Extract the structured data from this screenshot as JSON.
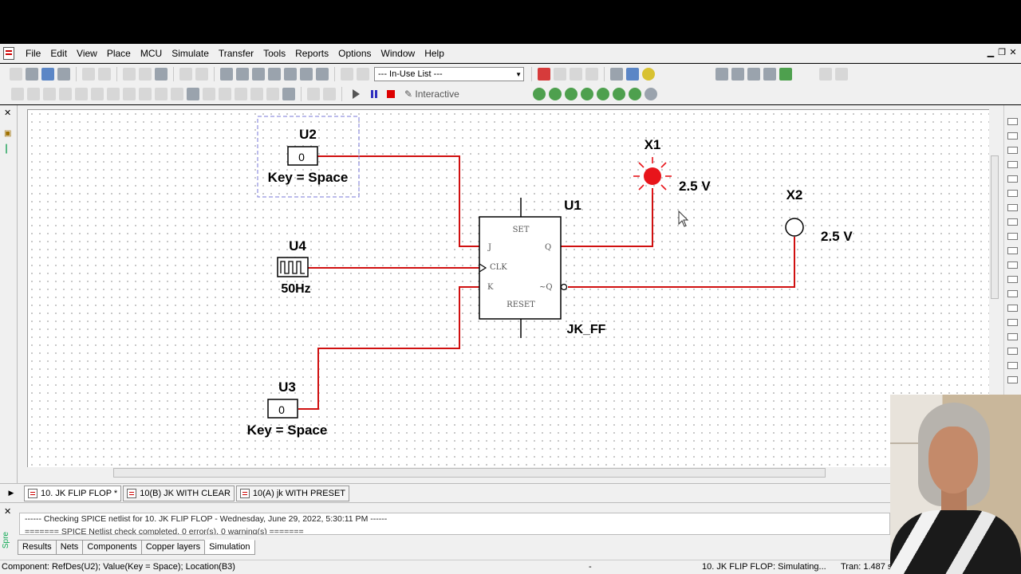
{
  "menu": {
    "items": [
      "File",
      "Edit",
      "View",
      "Place",
      "MCU",
      "Simulate",
      "Transfer",
      "Tools",
      "Reports",
      "Options",
      "Window",
      "Help"
    ]
  },
  "toolbar": {
    "in_use_list": "--- In-Use List ---",
    "interactive_label": "Interactive"
  },
  "circuit": {
    "u2": {
      "ref": "U2",
      "value": "0",
      "key": "Key = Space"
    },
    "u4": {
      "ref": "U4",
      "freq": "50Hz"
    },
    "u3": {
      "ref": "U3",
      "value": "0",
      "key": "Key = Space"
    },
    "u1": {
      "ref": "U1",
      "model": "JK_FF",
      "set": "SET",
      "reset": "RESET",
      "j": "J",
      "clk": "CLK",
      "k": "K",
      "q": "Q",
      "nq": "~Q"
    },
    "x1": {
      "ref": "X1",
      "voltage": "2.5 V",
      "state": "on"
    },
    "x2": {
      "ref": "X2",
      "voltage": "2.5 V",
      "state": "off"
    },
    "wire_color": "#d01010",
    "lamp_on_color": "#e8151b"
  },
  "tabs": [
    {
      "label": "10. JK FLIP FLOP *",
      "active": true
    },
    {
      "label": "10(B) JK WITH CLEAR",
      "active": false
    },
    {
      "label": "10(A) jk WITH PRESET",
      "active": false
    }
  ],
  "spreadsheet": {
    "side_label": "Spre",
    "log_line1": "------ Checking SPICE netlist for 10. JK FLIP FLOP - Wednesday, June 29, 2022, 5:30:11 PM ------",
    "log_line2": "======= SPICE Netlist check completed. 0 error(s), 0 warning(s) =======",
    "tabs": [
      "Results",
      "Nets",
      "Components",
      "Copper layers",
      "Simulation"
    ],
    "active_tab": "Simulation"
  },
  "status": {
    "component": "Component: RefDes(U2); Value(Key = Space); Location(B3)",
    "dash": "-",
    "sim": "10. JK FLIP FLOP: Simulating...",
    "tran": "Tran: 1.487 s"
  }
}
